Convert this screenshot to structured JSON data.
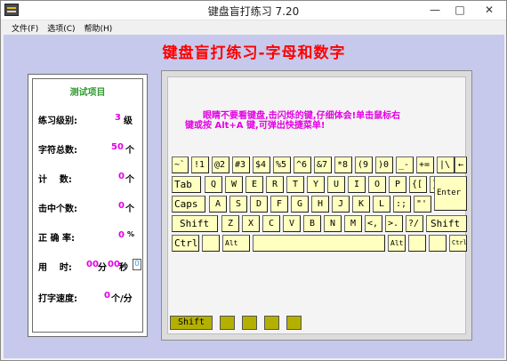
{
  "window": {
    "title": "键盘盲打练习 7.20",
    "controls": {
      "minimize": "—",
      "maximize": "□",
      "close": "✕"
    }
  },
  "menu": [
    {
      "label": "文件(F)"
    },
    {
      "label": "选项(C)"
    },
    {
      "label": "帮助(H)"
    }
  ],
  "heading": "键盘盲打练习-字母和数字",
  "stats": {
    "title": "测试项目",
    "level_label": "练习级别:",
    "level_value": "3",
    "level_unit": "级",
    "total_label": "字符总数:",
    "total_value": "50",
    "total_unit": "个",
    "count_label": "计    数:",
    "count_value": "0",
    "count_unit": "个",
    "hit_label": "击中个数:",
    "hit_value": "0",
    "hit_unit": "个",
    "accuracy_label": "正 确 率:",
    "accuracy_value": "0",
    "accuracy_unit": "%",
    "time_label": "用    时:",
    "time_min": "00",
    "time_min_unit": "分",
    "time_sec": "00",
    "time_sec_unit": "秒",
    "time_box": "0",
    "speed_label": "打字速度:",
    "speed_value": "0",
    "speed_unit": "个/分"
  },
  "instruction": {
    "line1": "眼睛不要看键盘,击闪烁的键,仔细体会!单击鼠标右",
    "line2": "键或按 Alt+A 键,可弹出快捷菜单!"
  },
  "keyboard": {
    "row1": [
      "~`",
      "!1",
      "@2",
      "#3",
      "$4",
      "%5",
      "^6",
      "&7",
      "*8",
      "(9",
      ")0",
      "_-",
      "+=",
      "|\\",
      "←"
    ],
    "row2": [
      "Tab",
      "Q",
      "W",
      "E",
      "R",
      "T",
      "Y",
      "U",
      "I",
      "O",
      "P",
      "{[",
      "}]"
    ],
    "row3": [
      "Caps",
      "A",
      "S",
      "D",
      "F",
      "G",
      "H",
      "J",
      "K",
      "L",
      ":;",
      "\"'",
      "Enter"
    ],
    "row4": [
      "Shift",
      "Z",
      "X",
      "C",
      "V",
      "B",
      "N",
      "M",
      "<,",
      ">.",
      "?/",
      "Shift"
    ],
    "row5": [
      "Ctrl",
      "",
      "Alt",
      "",
      "Alt",
      "",
      "",
      "Ctrl"
    ]
  },
  "indicators": {
    "shift": "Shift",
    "colors": {
      "indicator": "#b4b000",
      "key": "#ffffc0",
      "heading": "#ff0000",
      "accent": "#e400e4"
    }
  }
}
